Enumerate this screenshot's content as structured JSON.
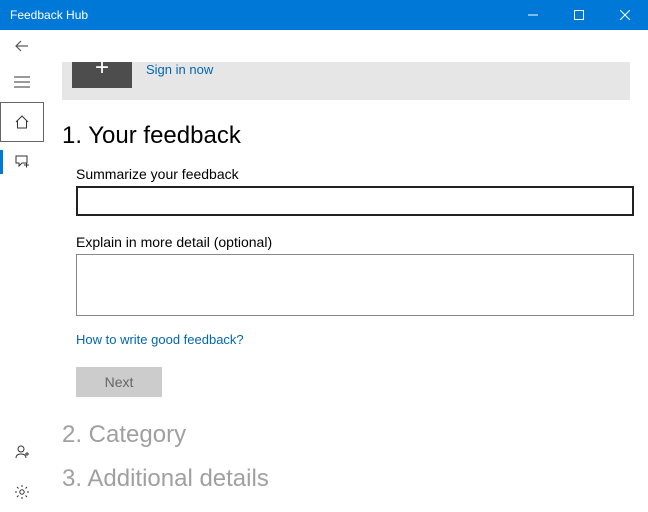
{
  "window": {
    "title": "Feedback Hub"
  },
  "signin": {
    "avatar_glyph": "+",
    "link_text": "Sign in now"
  },
  "steps": {
    "s1": {
      "title": "1. Your feedback",
      "summary_label": "Summarize your feedback",
      "summary_value": "",
      "detail_label": "Explain in more detail (optional)",
      "detail_value": "",
      "help_link": "How to write good feedback?",
      "next_button": "Next"
    },
    "s2": {
      "title": "2. Category"
    },
    "s3": {
      "title": "3. Additional details"
    }
  }
}
